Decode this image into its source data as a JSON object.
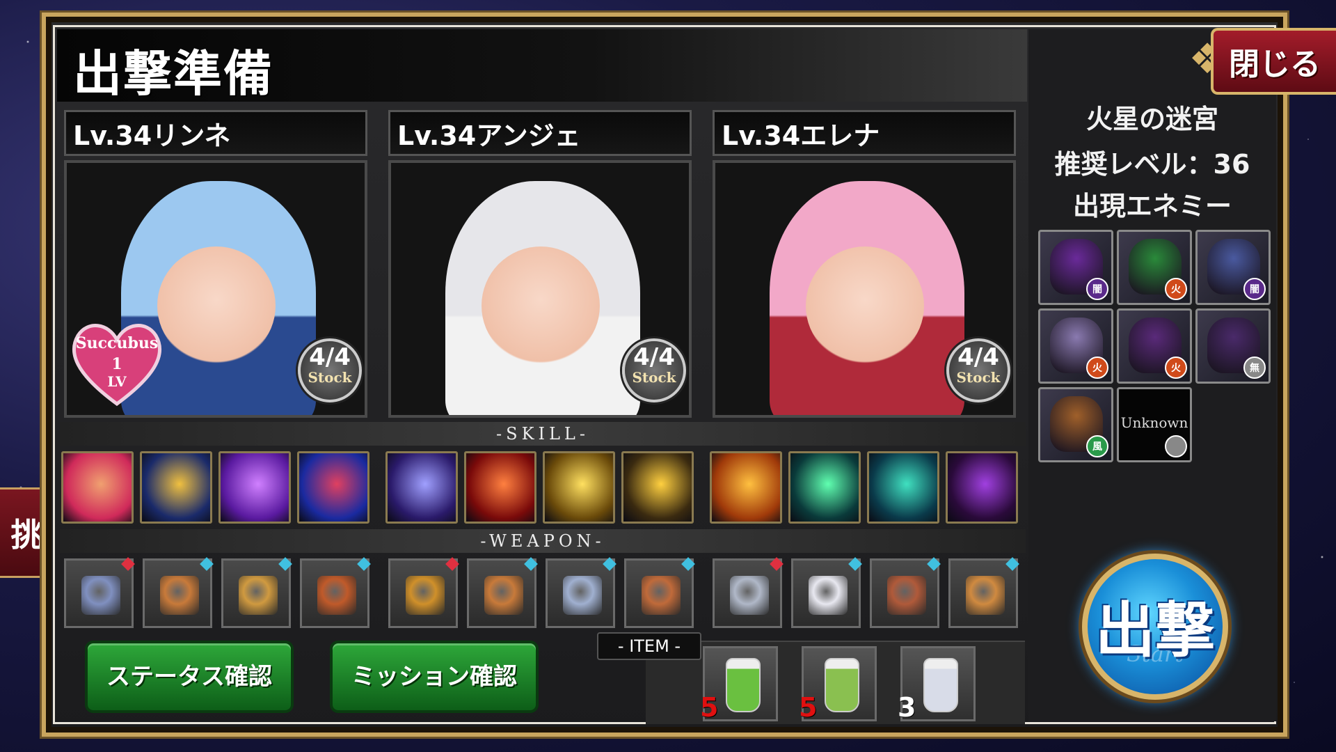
{
  "header": {
    "title": "出撃準備",
    "close_label": "閉じる"
  },
  "left_tab_label": "挑",
  "stage": {
    "name": "火星の迷宮",
    "recommended": "推奨レベル：36",
    "enemies_label": "出現エネミー"
  },
  "enemies": [
    {
      "elem": "闇",
      "color": "#6a2a9a",
      "elem_color": "#5a2a8a"
    },
    {
      "elem": "火",
      "color": "#2a8a3a",
      "elem_color": "#d04a1a"
    },
    {
      "elem": "闇",
      "color": "#4a5aa0",
      "elem_color": "#5a2a8a"
    },
    {
      "elem": "火",
      "color": "#8a7ab0",
      "elem_color": "#d04a1a"
    },
    {
      "elem": "火",
      "color": "#5a2a7a",
      "elem_color": "#d04a1a"
    },
    {
      "elem": "無",
      "color": "#4a2a6a",
      "elem_color": "#888888"
    },
    {
      "elem": "風",
      "color": "#a0602a",
      "elem_color": "#2a9a4a"
    },
    {
      "elem": "",
      "unknown_label": "Unknown",
      "elem_color": "#888888"
    }
  ],
  "characters": [
    {
      "name": "Lv.34リンネ",
      "stock": "4/4",
      "stock_label": "Stock",
      "hair": "#9cc8f0",
      "outfit": "#2a4a90",
      "badge": {
        "line1": "Succubus",
        "line2": "1",
        "line3": "LV"
      }
    },
    {
      "name": "Lv.34アンジェ",
      "stock": "4/4",
      "stock_label": "Stock",
      "hair": "#e6e6ea",
      "outfit": "#f2f2f2"
    },
    {
      "name": "Lv.34エレナ",
      "stock": "4/4",
      "stock_label": "Stock",
      "hair": "#f2a8c8",
      "outfit": "#b02a3a"
    }
  ],
  "sections": {
    "skill": "-SKILL-",
    "weapon": "-WEAPON-",
    "item": "- ITEM -"
  },
  "skills": [
    {
      "c1": "#d02a5a",
      "c2": "#f0a070"
    },
    {
      "c1": "#1a2a6a",
      "c2": "#f0c040"
    },
    {
      "c1": "#5a1aa0",
      "c2": "#d080ff"
    },
    {
      "c1": "#1a2aa0",
      "c2": "#e04060"
    },
    {
      "c1": "#2a1a6a",
      "c2": "#a0a0ff"
    },
    {
      "c1": "#7a0a0a",
      "c2": "#ff8040"
    },
    {
      "c1": "#6a4a0a",
      "c2": "#ffe060"
    },
    {
      "c1": "#3a2a10",
      "c2": "#ffd040"
    },
    {
      "c1": "#a03a0a",
      "c2": "#ffc040"
    },
    {
      "c1": "#0a3a3a",
      "c2": "#60ffb0"
    },
    {
      "c1": "#0a3a4a",
      "c2": "#40e0c0"
    },
    {
      "c1": "#2a0a3a",
      "c2": "#a040e0"
    }
  ],
  "weapons": [
    {
      "icon": "#8090c0",
      "gem": "#e03040"
    },
    {
      "icon": "#c87a3a",
      "gem": "#40c0e0"
    },
    {
      "icon": "#d09a40",
      "gem": "#40c0e0"
    },
    {
      "icon": "#c05a2a",
      "gem": "#40c0e0"
    },
    {
      "icon": "#d0902a",
      "gem": "#e03040"
    },
    {
      "icon": "#c87a3a",
      "gem": "#40c0e0"
    },
    {
      "icon": "#a0b0d0",
      "gem": "#40c0e0"
    },
    {
      "icon": "#c06a3a",
      "gem": "#40c0e0"
    },
    {
      "icon": "#b0b8c8",
      "gem": "#e03040"
    },
    {
      "icon": "#e8e8f0",
      "gem": "#40c0e0"
    },
    {
      "icon": "#b05a3a",
      "gem": "#40c0e0"
    },
    {
      "icon": "#d08a40",
      "gem": "#40c0e0"
    }
  ],
  "buttons": {
    "status": "ステータス確認",
    "mission": "ミッション確認",
    "start": "出撃",
    "start_sub": "Start"
  },
  "items": [
    {
      "count": "5",
      "color": "#6ac040",
      "count_color": "#e01010"
    },
    {
      "count": "5",
      "color": "#8ac050",
      "count_color": "#e01010"
    },
    {
      "count": "3",
      "color": "#d8dce8",
      "count_color": "#ffffff"
    }
  ]
}
